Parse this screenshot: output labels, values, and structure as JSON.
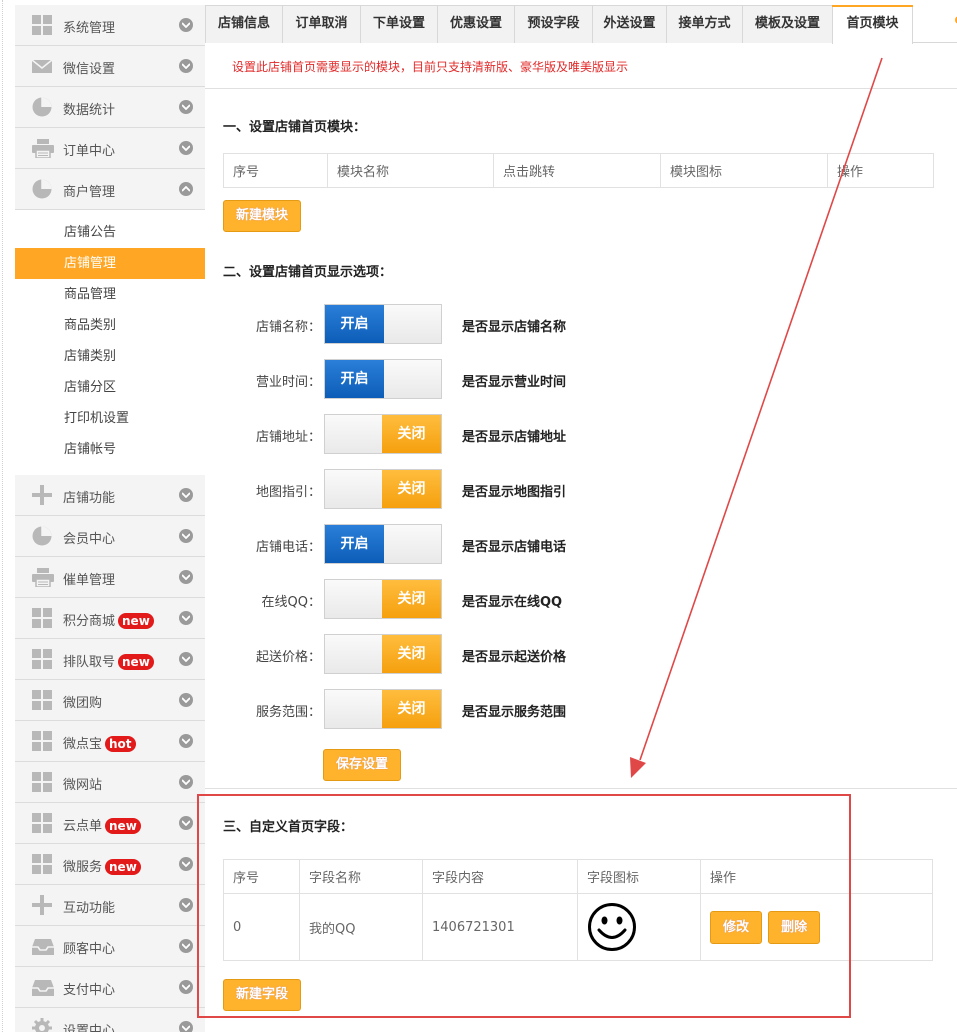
{
  "sidebar": {
    "menu_top": [
      {
        "label": "系统管理",
        "icon": "grid-icon"
      },
      {
        "label": "微信设置",
        "icon": "envelope-icon"
      },
      {
        "label": "数据统计",
        "icon": "pie-chart-icon"
      },
      {
        "label": "订单中心",
        "icon": "printer-icon"
      },
      {
        "label": "商户管理",
        "icon": "pie-chart-icon",
        "expanded": true
      }
    ],
    "submenu": [
      {
        "label": "店铺公告"
      },
      {
        "label": "店铺管理",
        "active": true
      },
      {
        "label": "商品管理"
      },
      {
        "label": "商品类别"
      },
      {
        "label": "店铺类别"
      },
      {
        "label": "店铺分区"
      },
      {
        "label": "打印机设置"
      },
      {
        "label": "店铺帐号"
      }
    ],
    "menu_bottom": [
      {
        "label": "店铺功能",
        "icon": "plus-icon",
        "badge": ""
      },
      {
        "label": "会员中心",
        "icon": "pie-chart-icon",
        "badge": ""
      },
      {
        "label": "催单管理",
        "icon": "printer-icon",
        "badge": ""
      },
      {
        "label": "积分商城",
        "icon": "grid-icon",
        "badge": "new"
      },
      {
        "label": "排队取号",
        "icon": "grid-icon",
        "badge": "new"
      },
      {
        "label": "微团购",
        "icon": "grid-icon",
        "badge": ""
      },
      {
        "label": "微点宝",
        "icon": "grid-icon",
        "badge": "hot"
      },
      {
        "label": "微网站",
        "icon": "grid-icon",
        "badge": ""
      },
      {
        "label": "云点单",
        "icon": "grid-icon",
        "badge": "new"
      },
      {
        "label": "微服务",
        "icon": "grid-icon",
        "badge": "new"
      },
      {
        "label": "互动功能",
        "icon": "plus-icon",
        "badge": ""
      },
      {
        "label": "顾客中心",
        "icon": "inbox-icon",
        "badge": ""
      },
      {
        "label": "支付中心",
        "icon": "inbox-icon",
        "badge": ""
      },
      {
        "label": "设置中心",
        "icon": "gear-icon",
        "badge": ""
      }
    ]
  },
  "tabs": [
    {
      "label": "店铺信息"
    },
    {
      "label": "订单取消"
    },
    {
      "label": "下单设置"
    },
    {
      "label": "优惠设置"
    },
    {
      "label": "预设字段"
    },
    {
      "label": "外送设置"
    },
    {
      "label": "接单方式"
    },
    {
      "label": "模板及设置"
    },
    {
      "label": "首页模块",
      "active": true
    }
  ],
  "notice": "设置此店铺首页需要显示的模块，目前只支持清新版、豪华版及唯美版显示",
  "section1": {
    "title": "一、设置店铺首页模块：",
    "columns": [
      "序号",
      "模块名称",
      "点击跳转",
      "模块图标",
      "操作"
    ],
    "new_button": "新建模块"
  },
  "section2": {
    "title": "二、设置店铺首页显示选项：",
    "options": [
      {
        "label": "店铺名称：",
        "state": "开启",
        "on": true,
        "desc": "是否显示店铺名称"
      },
      {
        "label": "营业时间：",
        "state": "开启",
        "on": true,
        "desc": "是否显示营业时间"
      },
      {
        "label": "店铺地址：",
        "state": "关闭",
        "on": false,
        "desc": "是否显示店铺地址"
      },
      {
        "label": "地图指引：",
        "state": "关闭",
        "on": false,
        "desc": "是否显示地图指引"
      },
      {
        "label": "店铺电话：",
        "state": "开启",
        "on": true,
        "desc": "是否显示店铺电话"
      },
      {
        "label": "在线QQ：",
        "state": "关闭",
        "on": false,
        "desc": "是否显示在线QQ"
      },
      {
        "label": "起送价格：",
        "state": "关闭",
        "on": false,
        "desc": "是否显示起送价格"
      },
      {
        "label": "服务范围：",
        "state": "关闭",
        "on": false,
        "desc": "是否显示服务范围"
      }
    ],
    "save_button": "保存设置"
  },
  "section3": {
    "title": "三、自定义首页字段：",
    "columns": [
      "序号",
      "字段名称",
      "字段内容",
      "字段图标",
      "操作"
    ],
    "rows": [
      {
        "index": "0",
        "name": "我的QQ",
        "content": "1406721301",
        "icon": "smiley-icon",
        "edit": "修改",
        "delete": "删除"
      }
    ],
    "new_button": "新建字段"
  },
  "colors": {
    "accent": "#ffa724",
    "toggle_on": "#0c5db7",
    "highlight": "#e04848",
    "notice": "#e02a2a"
  }
}
